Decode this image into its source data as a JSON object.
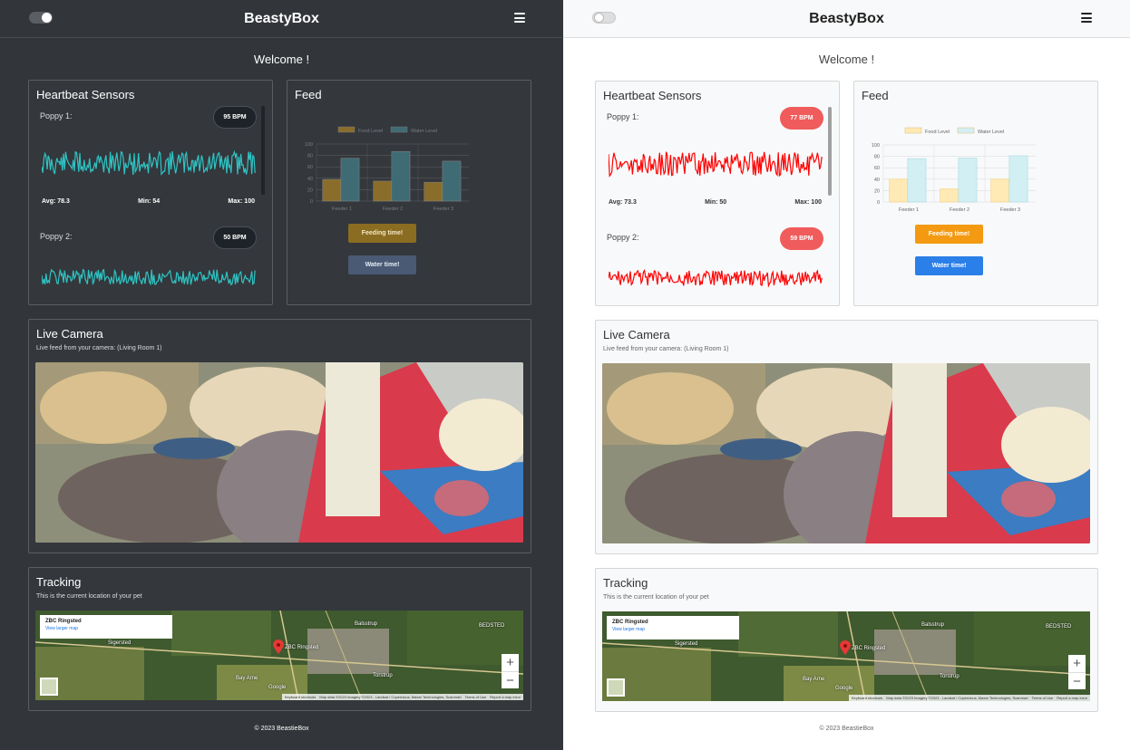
{
  "app": {
    "brand": "BeastyBox",
    "welcome": "Welcome !"
  },
  "heartbeat": {
    "title": "Heartbeat Sensors",
    "stats_labels": {
      "avg": "Avg:",
      "min": "Min:",
      "max": "Max:"
    },
    "dark": {
      "pets": [
        {
          "name": "Poppy 1:",
          "bpm": "95 BPM",
          "avg": "Avg: 78.3",
          "min": "Min: 54",
          "max": "Max: 100"
        },
        {
          "name": "Poppy 2:",
          "bpm": "50 BPM"
        }
      ],
      "wave_color": "#2ec4c4"
    },
    "light": {
      "pets": [
        {
          "name": "Poppy 1:",
          "bpm": "77 BPM",
          "avg": "Avg: 73.3",
          "min": "Min: 50",
          "max": "Max: 100"
        },
        {
          "name": "Poppy 2:",
          "bpm": "59 BPM"
        }
      ],
      "wave_color": "#ff0000"
    }
  },
  "feed": {
    "title": "Feed",
    "feeding_button": "Feeding time!",
    "water_button": "Water time!",
    "chart_data": [
      {
        "type": "bar",
        "theme": "dark",
        "categories": [
          "Feeder 1",
          "Feeder 2",
          "Feeder 3"
        ],
        "series": [
          {
            "name": "Food Level",
            "values": [
              38,
              35,
              33
            ],
            "color": "#8a6d2a"
          },
          {
            "name": "Water Level",
            "values": [
              75,
              87,
              70
            ],
            "color": "#3f6b74"
          }
        ],
        "yticks": [
          0,
          20,
          40,
          60,
          80,
          100
        ],
        "ylim": [
          0,
          100
        ],
        "legend": "top",
        "grid": true
      },
      {
        "type": "bar",
        "theme": "light",
        "categories": [
          "Feeder 1",
          "Feeder 2",
          "Feeder 3"
        ],
        "series": [
          {
            "name": "Food Level",
            "values": [
              40,
              23,
              40
            ],
            "color": "#ffe9b5"
          },
          {
            "name": "Water Level",
            "values": [
              76,
              77,
              81
            ],
            "color": "#d2eff3"
          }
        ],
        "yticks": [
          0,
          20,
          40,
          60,
          80,
          100
        ],
        "ylim": [
          0,
          100
        ],
        "legend": "top",
        "grid": true
      }
    ]
  },
  "camera": {
    "title": "Live Camera",
    "subtitle": "Live feed from your camera: (Living Room 1)"
  },
  "tracking": {
    "title": "Tracking",
    "subtitle": "This is the current location of your pet",
    "map_place": "ZBC Ringsted",
    "map_link": "View larger map",
    "zoom_in": "+",
    "zoom_out": "−",
    "labels": {
      "pin": "ZBC Ringsted",
      "bay": "Bay Arne",
      "town1": "Sigersted",
      "town2": "Torstrup",
      "town3": "Balsstrup",
      "town4": "BEDSTED",
      "google": "Google"
    },
    "footer": [
      "Keyboard shortcuts",
      "Map data ©2023 Imagery ©2023 , Landsat / Copernicus, Maxar Technologies, Scanmart",
      "Terms of Use",
      "Report a map error"
    ]
  },
  "footer": "© 2023 BeastieBox"
}
